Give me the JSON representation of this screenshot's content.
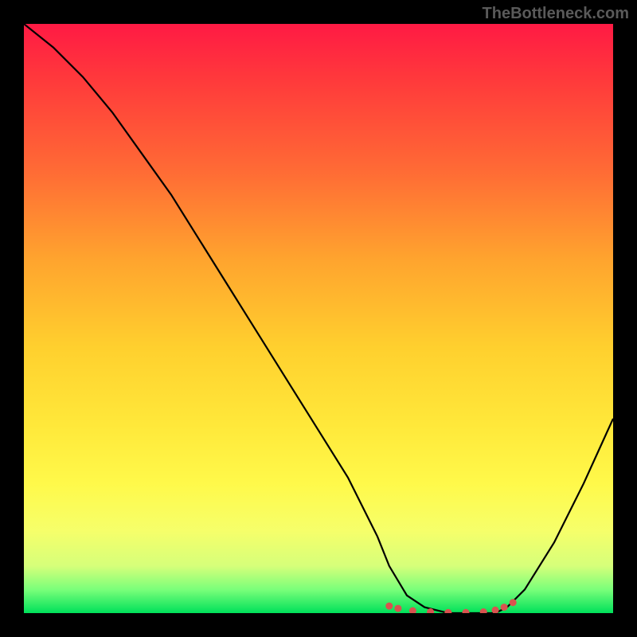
{
  "watermark": "TheBottleneck.com",
  "chart_data": {
    "type": "line",
    "title": "",
    "xlabel": "",
    "ylabel": "",
    "xlim": [
      0,
      100
    ],
    "ylim": [
      0,
      100
    ],
    "series": [
      {
        "name": "bottleneck-curve",
        "x": [
          0,
          5,
          10,
          15,
          20,
          25,
          30,
          35,
          40,
          45,
          50,
          55,
          60,
          62,
          65,
          68,
          72,
          76,
          80,
          82,
          85,
          90,
          95,
          100
        ],
        "y": [
          100,
          96,
          91,
          85,
          78,
          71,
          63,
          55,
          47,
          39,
          31,
          23,
          13,
          8,
          3,
          1,
          0,
          0,
          0,
          1,
          4,
          12,
          22,
          33
        ]
      }
    ],
    "markers": {
      "name": "highlight-dots",
      "color": "#d9534f",
      "x": [
        62,
        63.5,
        66,
        69,
        72,
        75,
        78,
        80,
        81.5,
        83
      ],
      "y": [
        1.2,
        0.8,
        0.4,
        0.2,
        0.1,
        0.1,
        0.2,
        0.5,
        1.0,
        1.8
      ]
    },
    "gradient_stops": [
      {
        "pos": 0,
        "color": "#ff1a44"
      },
      {
        "pos": 25,
        "color": "#ff6b35"
      },
      {
        "pos": 55,
        "color": "#ffd02e"
      },
      {
        "pos": 78,
        "color": "#fff94a"
      },
      {
        "pos": 96,
        "color": "#7aff7a"
      },
      {
        "pos": 100,
        "color": "#00e05a"
      }
    ]
  }
}
